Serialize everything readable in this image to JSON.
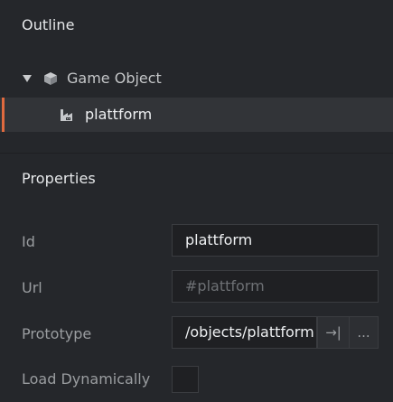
{
  "outline": {
    "title": "Outline",
    "root": {
      "label": "Game Object",
      "icon": "game-object-cube-icon"
    },
    "child": {
      "label": "plattform",
      "icon": "collection-factory-icon"
    },
    "selection_color": "#e06a3f"
  },
  "properties": {
    "title": "Properties",
    "id": {
      "label": "Id",
      "value": "plattform"
    },
    "url": {
      "label": "Url",
      "placeholder": "#plattform"
    },
    "prototype": {
      "label": "Prototype",
      "value": "/objects/plattform",
      "goto_icon": "→|",
      "browse_label": "..."
    },
    "load_dynamically": {
      "label": "Load Dynamically",
      "checked": false
    }
  }
}
